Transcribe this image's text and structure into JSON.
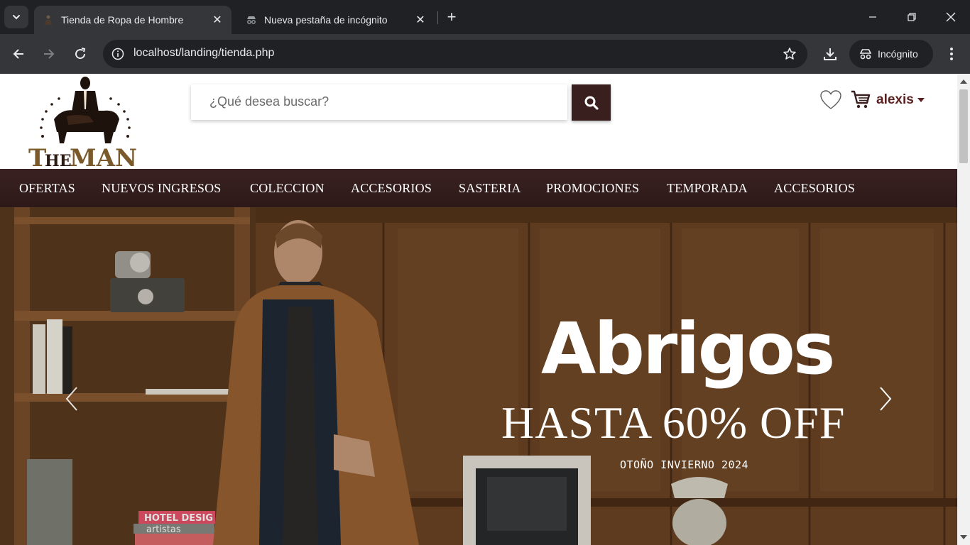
{
  "browser": {
    "tabs": [
      {
        "title": "Tienda de Ropa de Hombre",
        "active": true
      },
      {
        "title": "Nueva pestaña de incógnito",
        "active": false
      }
    ],
    "url": "localhost/landing/tienda.php",
    "incognito_label": "Incógnito"
  },
  "site": {
    "logo_text": "TheMAN",
    "search_placeholder": "¿Qué desea buscar?",
    "user_name": "alexis",
    "nav_items": [
      "OFERTAS",
      "NUEVOS INGRESOS",
      "COLECCION",
      "ACCESORIOS",
      "SASTERIA",
      "PROMOCIONES",
      "TEMPORADA",
      "ACCESORIOS"
    ]
  },
  "hero": {
    "title": "Abrigos",
    "subtitle": "HASTA 60% OFF",
    "season": "OTOÑO INVIERNO 2024",
    "book_text_1": "HOTEL DESIG",
    "book_text_2": "artistas"
  },
  "colors": {
    "brand_dark": "#3a1f1f",
    "user_color": "#5a1f1f",
    "chrome_bg": "#202124",
    "chrome_toolbar": "#35363a"
  }
}
